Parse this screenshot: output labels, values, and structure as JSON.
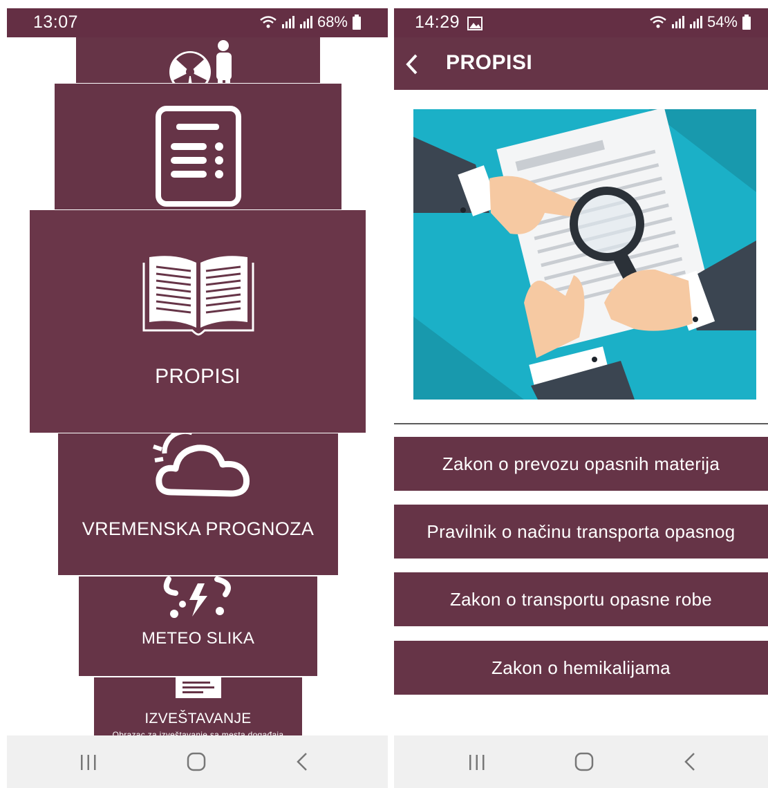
{
  "left_screen": {
    "status_bar": {
      "time": "13:07",
      "battery": "68%"
    },
    "menu": {
      "propisi_label": "PROPISI",
      "weather_label": "VREMENSKA PROGNOZA",
      "meteo_label": "METEO SLIKA",
      "report_label": "IZVEŠTAVANJE",
      "report_subtitle": "Obrazac za izveštavanje sa mesta događaja"
    }
  },
  "right_screen": {
    "status_bar": {
      "time": "14:29",
      "battery": "54%"
    },
    "app_bar": {
      "title": "PROPISI"
    },
    "laws": [
      {
        "label": "Zakon o prevozu opasnih materija"
      },
      {
        "label": "Pravilnik o načinu transporta opasnog"
      },
      {
        "label": "Zakon o transportu opasne robe"
      },
      {
        "label": "Zakon o hemikalijama"
      }
    ]
  },
  "icons": {
    "card_top": "radiation-person-icon",
    "card_list": "document-list-icon",
    "propisi": "open-book-icon",
    "weather": "sun-cloud-icon",
    "meteo": "storm-cloud-icon",
    "report": "report-form-icon",
    "hero": "magnifier-document-illustration",
    "nav": [
      "recent-apps-icon",
      "home-icon",
      "back-icon"
    ]
  },
  "colors": {
    "primary": "#663447",
    "status_bar": "#642f44",
    "hero_background": "#1bb0c7",
    "nav_bar": "#f0f0f0"
  }
}
